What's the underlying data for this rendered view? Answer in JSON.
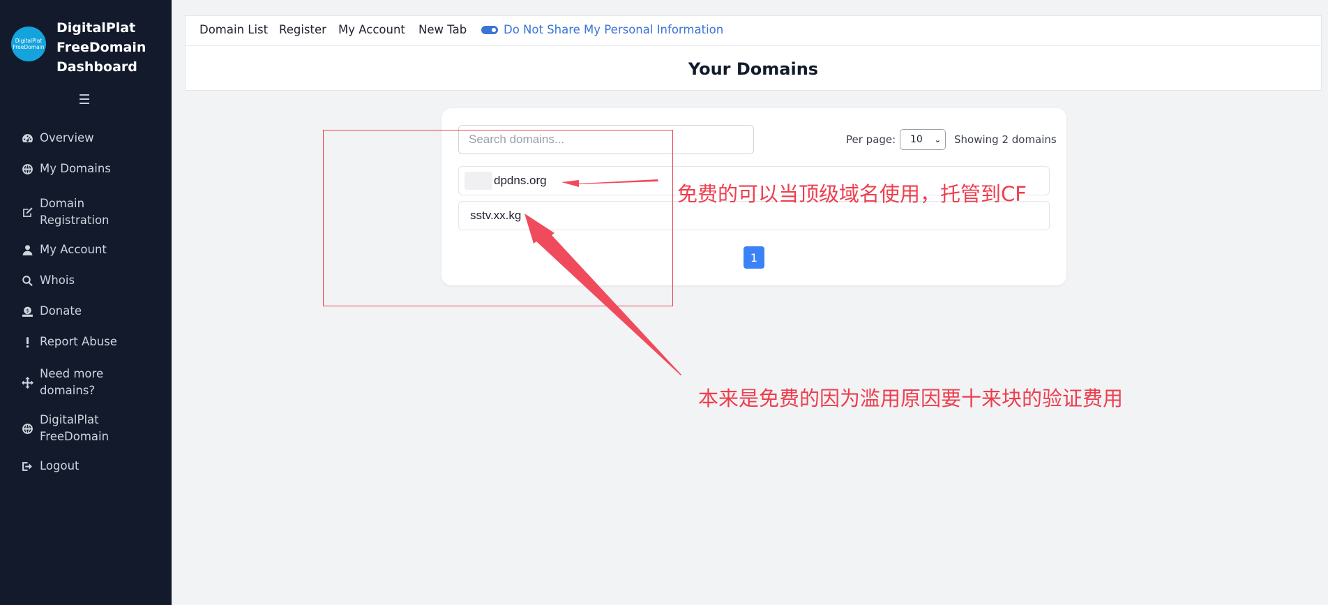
{
  "sidebar": {
    "logo_line1": "DigitalPlat",
    "logo_line2": "FreeDomain",
    "brand_line1": "DigitalPlat",
    "brand_line2": "FreeDomain",
    "brand_line3": "Dashboard",
    "menu_icon": "hamburger-icon",
    "items": [
      {
        "label": "Overview",
        "icon": "dashboard-icon"
      },
      {
        "label": "My Domains",
        "icon": "globe-icon"
      },
      {
        "label": "Domain Registration",
        "icon": "edit-icon"
      },
      {
        "label": "My Account",
        "icon": "user-icon"
      },
      {
        "label": "Whois",
        "icon": "search-icon"
      },
      {
        "label": "Donate",
        "icon": "donate-icon"
      },
      {
        "label": "Report Abuse",
        "icon": "exclamation-icon"
      },
      {
        "label": "Need more domains?",
        "icon": "move-icon"
      },
      {
        "label": "DigitalPlat FreeDomain",
        "icon": "globe-icon"
      },
      {
        "label": "Logout",
        "icon": "logout-icon"
      }
    ]
  },
  "topnav": {
    "items": [
      "Domain List",
      "Register",
      "My Account",
      "New Tab"
    ],
    "privacy_link": "Do Not Share My Personal Information"
  },
  "page_title": "Your Domains",
  "domains_card": {
    "search_placeholder": "Search domains...",
    "per_page_label": "Per page:",
    "per_page_value": "10",
    "showing_text": "Showing 2 domains",
    "domains": [
      "dpdns.org",
      "sstv.xx.kg"
    ],
    "current_page": "1"
  },
  "annotations": {
    "note1": "免费的可以当顶级域名使用，托管到CF",
    "note2": "本来是免费的因为滥用原因要十来块的验证费用",
    "color": "#ee3e4e"
  }
}
